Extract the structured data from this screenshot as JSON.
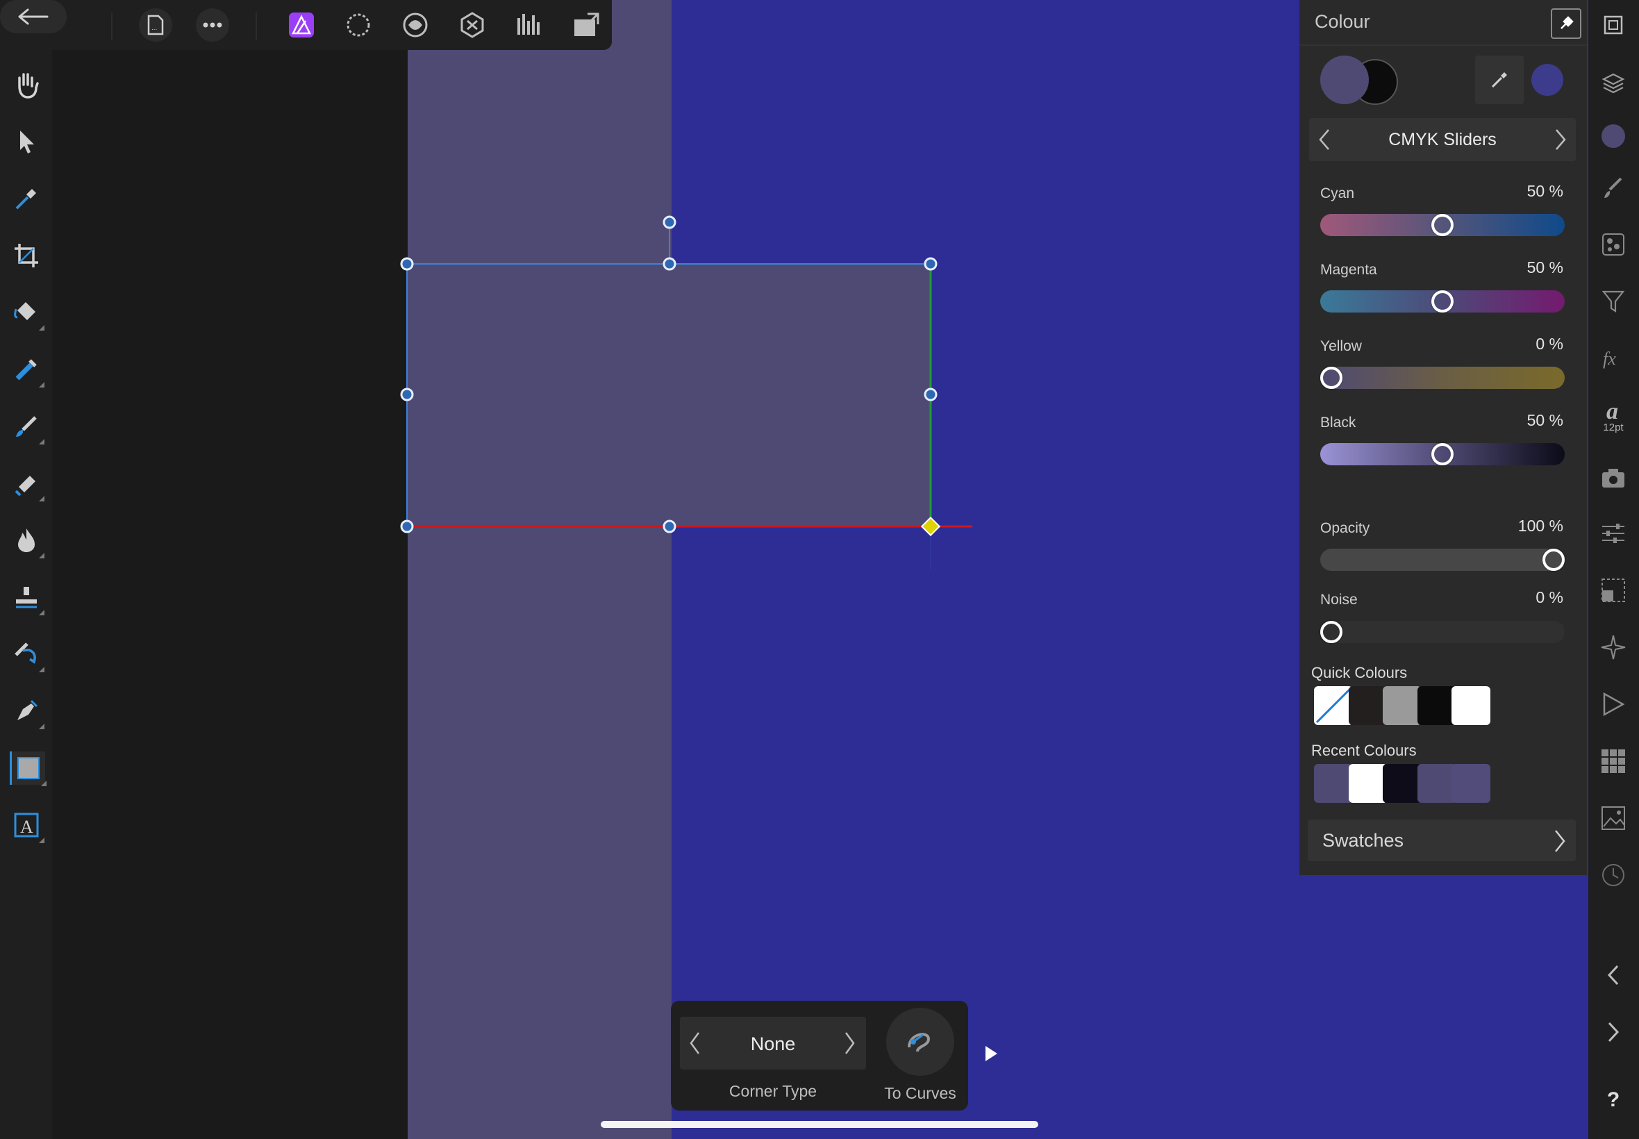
{
  "colors": {
    "canvas_purple": "#4f4a73",
    "canvas_blue": "#2d2d95",
    "accent": "#2d8fdd",
    "selection_blue": "#3b82d6"
  },
  "top_toolbar": {
    "icons": [
      "back-arrow-icon",
      "document-icon",
      "more-icon",
      "photo-persona-icon",
      "selection-persona-icon",
      "liquify-persona-icon",
      "develop-persona-icon",
      "tone-mapping-persona-icon",
      "export-persona-icon"
    ]
  },
  "left_toolbar": {
    "tools": [
      "hand-tool-icon",
      "move-tool-icon",
      "color-picker-tool-icon",
      "crop-tool-icon",
      "flood-fill-tool-icon",
      "selection-brush-tool-icon",
      "paint-brush-tool-icon",
      "erase-brush-tool-icon",
      "dodge-burn-tool-icon",
      "clone-tool-icon",
      "healing-tool-icon",
      "pen-tool-icon",
      "rectangle-tool-icon",
      "text-tool-icon"
    ]
  },
  "colour_panel": {
    "title": "Colour",
    "mode_label": "CMYK Sliders",
    "primary_colour": "#4f4a73",
    "secondary_colour": "#0c0c0c",
    "picked_colour": "#3d3b8c",
    "sliders": [
      {
        "label": "Cyan",
        "value": "50 %",
        "fraction": 0.5
      },
      {
        "label": "Magenta",
        "value": "50 %",
        "fraction": 0.5
      },
      {
        "label": "Yellow",
        "value": "0 %",
        "fraction": 0.0
      },
      {
        "label": "Black",
        "value": "50 %",
        "fraction": 0.5
      }
    ],
    "opacity": {
      "label": "Opacity",
      "value": "100 %",
      "fraction": 1.0
    },
    "noise": {
      "label": "Noise",
      "value": "0 %",
      "fraction": 0.0
    },
    "quick_colours_label": "Quick Colours",
    "quick_colours": [
      "none",
      "#231f1f",
      "#9a9a9a",
      "#0b0b0b",
      "#ffffff"
    ],
    "recent_colours_label": "Recent Colours",
    "recent_colours": [
      "#4f4a73",
      "#ffffff",
      "#0d0c18",
      "#4f4a73",
      "#524c7a"
    ],
    "swatches_label": "Swatches"
  },
  "right_bar": {
    "icons": [
      "navigator-icon",
      "layers-icon",
      "colour-icon",
      "brushes-icon",
      "channels-icon",
      "filter-icon",
      "fx-icon",
      "text-style-icon",
      "camera-icon",
      "adjustments-icon",
      "transform-icon",
      "snapping-icon",
      "macro-icon",
      "grid-icon",
      "stock-icon",
      "history-icon",
      "chevron-left-icon",
      "chevron-right-icon",
      "help-icon"
    ],
    "text_style_label": "12pt",
    "help_label": "?"
  },
  "context_bar": {
    "corner_type_value": "None",
    "corner_type_label": "Corner Type",
    "to_curves_label": "To Curves"
  }
}
